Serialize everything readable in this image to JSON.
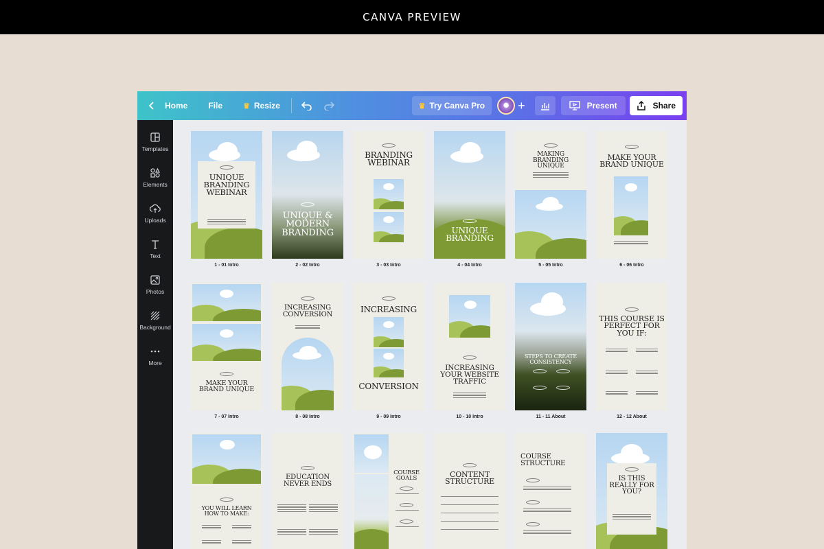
{
  "header": {
    "title": "CANVA PREVIEW"
  },
  "toolbar": {
    "home": "Home",
    "file": "File",
    "resize": "Resize",
    "try_pro": "Try Canva Pro",
    "present": "Present",
    "share": "Share"
  },
  "sidebar": {
    "items": [
      {
        "label": "Templates",
        "icon": "templates-icon"
      },
      {
        "label": "Elements",
        "icon": "elements-icon"
      },
      {
        "label": "Uploads",
        "icon": "upload-icon"
      },
      {
        "label": "Text",
        "icon": "text-icon"
      },
      {
        "label": "Photos",
        "icon": "photos-icon"
      },
      {
        "label": "Background",
        "icon": "background-icon"
      },
      {
        "label": "More",
        "icon": "more-icon"
      }
    ]
  },
  "pages": [
    {
      "label": "1 - 01 Intro",
      "title": "UNIQUE BRANDING WEBINAR"
    },
    {
      "label": "2 - 02 Intro",
      "title": "UNIQUE & MODERN BRANDING"
    },
    {
      "label": "3 - 03 Intro",
      "title": "BRANDING WEBINAR"
    },
    {
      "label": "4 - 04 Intro",
      "title": "UNIQUE BRANDING"
    },
    {
      "label": "5 - 05 Intro",
      "title": "MAKING BRANDING UNIQUE"
    },
    {
      "label": "6 - 06 Intro",
      "title": "MAKE YOUR BRAND UNIQUE"
    },
    {
      "label": "7 - 07 Intro",
      "title": "MAKE YOUR BRAND UNIQUE"
    },
    {
      "label": "8 - 08 Intro",
      "title": "INCREASING CONVERSION"
    },
    {
      "label": "9 - 09 Intro",
      "title": "INCREASING",
      "title2": "CONVERSION"
    },
    {
      "label": "10 - 10 Intro",
      "title": "INCREASING YOUR WEBSITE TRAFFIC"
    },
    {
      "label": "11 - 11 About",
      "title": "STEPS TO CREATE CONSISTENCY"
    },
    {
      "label": "12 - 12 About",
      "title": "THIS COURSE IS PERFECT FOR YOU IF:"
    },
    {
      "label": "",
      "title": "YOU WILL LEARN HOW TO MAKE:"
    },
    {
      "label": "",
      "title": "EDUCATION NEVER ENDS"
    },
    {
      "label": "",
      "title": "COURSE GOALS"
    },
    {
      "label": "",
      "title": "CONTENT STRUCTURE"
    },
    {
      "label": "",
      "title": "COURSE STRUCTURE"
    },
    {
      "label": "",
      "title": "IS THIS REALLY FOR YOU?"
    }
  ],
  "colors": {
    "accent_gradient_start": "#3ec3c9",
    "accent_gradient_end": "#7b3ff0",
    "sidebar_bg": "#18191b",
    "hill_dark": "#7e9a35",
    "hill_light": "#a8c25a",
    "sky": "#b6d6f1"
  }
}
